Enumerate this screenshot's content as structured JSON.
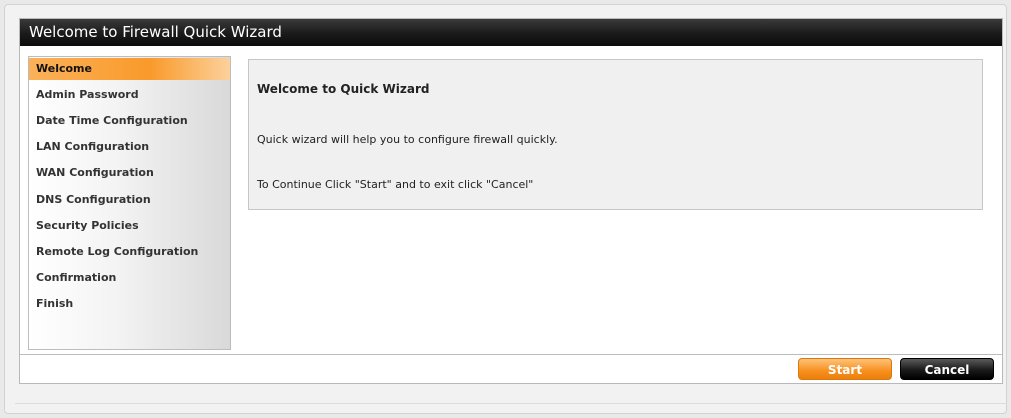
{
  "window": {
    "title": "Welcome to Firewall Quick Wizard"
  },
  "sidebar": {
    "items": [
      {
        "label": "Welcome",
        "active": true
      },
      {
        "label": "Admin Password",
        "active": false
      },
      {
        "label": "Date Time Configuration",
        "active": false
      },
      {
        "label": "LAN Configuration",
        "active": false
      },
      {
        "label": "WAN Configuration",
        "active": false
      },
      {
        "label": "DNS Configuration",
        "active": false
      },
      {
        "label": "Security Policies",
        "active": false
      },
      {
        "label": "Remote Log Configuration",
        "active": false
      },
      {
        "label": "Confirmation",
        "active": false
      },
      {
        "label": "Finish",
        "active": false
      }
    ]
  },
  "content": {
    "heading": "Welcome to Quick Wizard",
    "line1": "Quick wizard will help you to configure firewall quickly.",
    "line2": "To Continue Click \"Start\" and to exit click \"Cancel\""
  },
  "buttons": {
    "start": "Start",
    "cancel": "Cancel"
  },
  "colors": {
    "accent": "#f99a2a",
    "titlebar": "#1a1a1a"
  }
}
